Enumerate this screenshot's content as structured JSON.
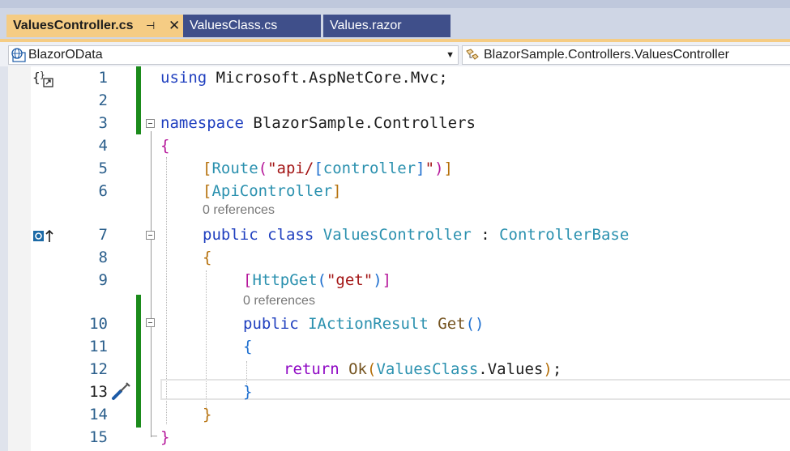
{
  "tabs": [
    {
      "label": "ValuesController.cs",
      "active": true,
      "pin_glyph": "⊣",
      "close_glyph": "✕"
    },
    {
      "label": "ValuesClass.cs",
      "active": false
    },
    {
      "label": "Values.razor",
      "active": false
    }
  ],
  "navbar": {
    "project": "BlazorOData",
    "type_path": "BlazorSample.Controllers.ValuesController",
    "project_icon": "globe-icon",
    "type_icon": "class-icon"
  },
  "editor": {
    "line_numbers": [
      "1",
      "2",
      "3",
      "4",
      "5",
      "6",
      "7",
      "8",
      "9",
      "10",
      "11",
      "12",
      "13",
      "14",
      "15"
    ],
    "current_line": "13",
    "code_lens": [
      "0 references",
      "0 references"
    ],
    "tokens": {
      "using": "using",
      "ns_mvc": "Microsoft.AspNetCore.Mvc",
      "semicolon": ";",
      "namespace": "namespace",
      "ns_name": "BlazorSample.Controllers",
      "open_brace": "{",
      "close_brace": "}",
      "open_bracket": "[",
      "close_bracket": "]",
      "route": "Route",
      "open_paren": "(",
      "close_paren": ")",
      "route_str_a": "\"api/",
      "controller_tok": "controller",
      "route_str_b": "\"",
      "apicontroller": "ApiController",
      "public": "public",
      "class": "class",
      "class_name": "ValuesController",
      "colon": " : ",
      "base": "ControllerBase",
      "httpget": "HttpGet",
      "get_str": "\"get\"",
      "iaction": "IActionResult",
      "get_name": "Get",
      "empty_parens": "()",
      "return": "return",
      "ok": "Ok",
      "values_class": "ValuesClass",
      "dot": ".",
      "values_prop": "Values"
    },
    "colors": {
      "keyword": "#1f3fbf",
      "type": "#2b91af",
      "string": "#a31515",
      "control": "#8f08c4",
      "change_bar": "#1b8b1b",
      "active_tab": "#f5cc84",
      "inactive_tab": "#3f4f8a"
    },
    "margin_icons": [
      "namespace-scope-icon",
      "implements-icon",
      "quick-action-screwdriver-icon"
    ]
  }
}
